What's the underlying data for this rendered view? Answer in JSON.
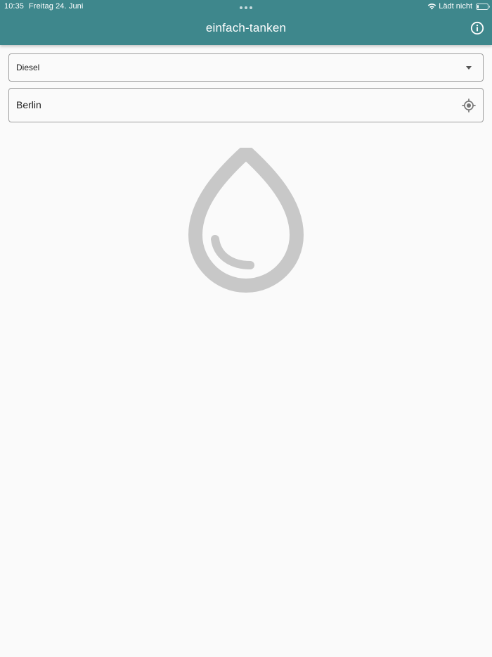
{
  "status_bar": {
    "time": "10:35",
    "date": "Freitag 24. Juni",
    "charging": "Lädt nicht",
    "battery_level": 0.1
  },
  "app_bar": {
    "title": "einfach-tanken",
    "info_icon": "info-icon"
  },
  "fuel_select": {
    "selected": "Diesel",
    "icon": "dropdown-arrow-icon"
  },
  "location": {
    "value": "Berlin",
    "icon": "my-location-icon"
  },
  "empty_state": {
    "icon": "water-drop-icon"
  },
  "colors": {
    "app_bar": "#3e878c",
    "background": "#fafafa",
    "field_border": "#9e9e9e",
    "empty_icon": "#c8c8c8"
  }
}
